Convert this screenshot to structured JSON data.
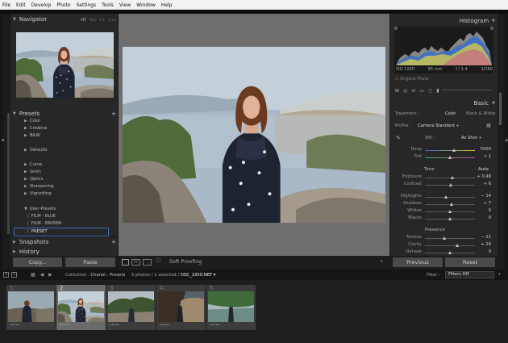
{
  "menu": [
    "File",
    "Edit",
    "Develop",
    "Photo",
    "Settings",
    "Tools",
    "View",
    "Window",
    "Help"
  ],
  "navigator": {
    "title": "Navigator",
    "zoom": [
      "FIT",
      "FILL",
      "1:1",
      "1:1 ▾"
    ]
  },
  "presets": {
    "title": "Presets",
    "groups1": [
      "Color",
      "Creative",
      "B&W"
    ],
    "groups2": [
      "Defaults"
    ],
    "groups3": [
      "Curve",
      "Grain",
      "Optics",
      "Sharpening",
      "Vignetting"
    ],
    "user_title": "User Presets",
    "user_items": [
      "FILM - BLUE",
      "FILM - BROWN",
      "PRESET"
    ]
  },
  "snapshots": {
    "title": "Snapshots"
  },
  "history": {
    "title": "History"
  },
  "left_buttons": {
    "copy": "Copy...",
    "paste": "Paste"
  },
  "toolbar": {
    "soft_proofing": "Soft Proofing"
  },
  "histogram": {
    "title": "Histogram",
    "iso": "ISO 1100",
    "focal": "85 mm",
    "aperture": "f / 1.4",
    "shutter": "1/160",
    "original": "Original Photo"
  },
  "basic": {
    "title": "Basic",
    "treatment_label": "Treatment :",
    "color": "Color",
    "bw": "Black & White",
    "profile_label": "Profile :",
    "profile_value": "Camera Standard ÷",
    "wb_label": "WB :",
    "wb_value": "As Shot ÷",
    "temp_label": "Temp",
    "temp_value": "5000",
    "tint_label": "Tint",
    "tint_value": "+ 1",
    "tone_label": "Tone",
    "auto": "Auto",
    "exposure_label": "Exposure",
    "exposure_value": "+ 0,48",
    "contrast_label": "Contrast",
    "contrast_value": "+ 6",
    "highlights_label": "Highlights",
    "highlights_value": "− 14",
    "shadows_label": "Shadows",
    "shadows_value": "+ 7",
    "whites_label": "Whites",
    "whites_value": "0",
    "blacks_label": "Blacks",
    "blacks_value": "0",
    "presence_label": "Presence",
    "texture_label": "Texture",
    "texture_value": "− 21",
    "clarity_label": "Clarity",
    "clarity_value": "+ 29",
    "dehaze_label": "Dehaze",
    "dehaze_value": "0"
  },
  "right_buttons": {
    "previous": "Previous",
    "reset": "Reset"
  },
  "filmstrip": {
    "pages": [
      "1",
      "2"
    ],
    "collection_label": "Collection :",
    "collection_name": "Chanel - Presets",
    "info": "5 photos / 1 selected /",
    "filename": "DSC_1950.NEF ▾",
    "filter_label": "Filter :",
    "filter_value": "Filters Off",
    "thumb_numbers": [
      "1",
      "2",
      "3",
      "4",
      "5"
    ],
    "thumb_stars": [
      "•••••",
      "•••••",
      "•••••",
      "•••••",
      "•••••"
    ]
  },
  "colors": {
    "accent": "#3d6fae",
    "panel": "#272727",
    "background": "#1b1b1b"
  }
}
